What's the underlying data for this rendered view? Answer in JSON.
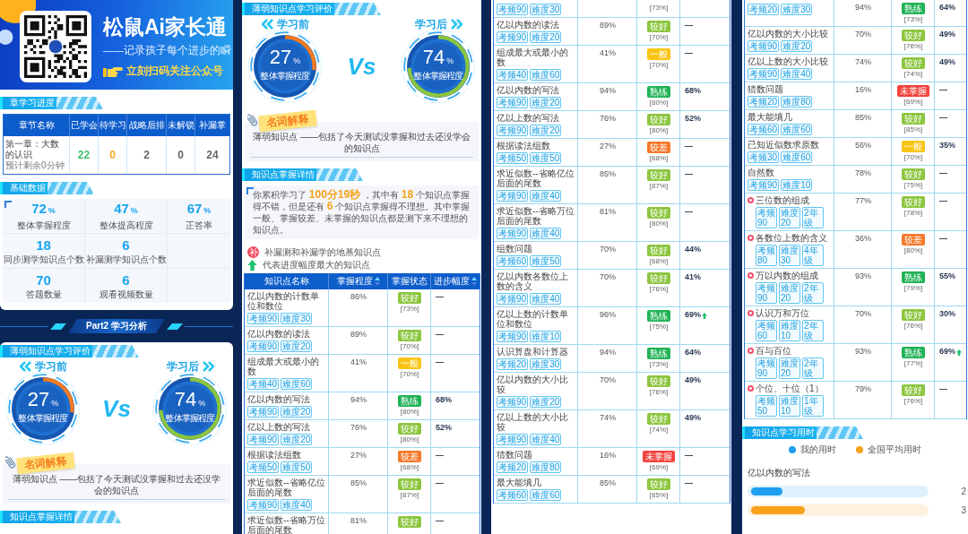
{
  "screens": [
    {
      "blocks": [
        {
          "kind": "card",
          "sections": [
            {
              "kind": "banner",
              "title": "松鼠Ai家长通",
              "subtitle": "——记录孩子每个进步的瞬",
              "cta": "立刻扫码关注公众号"
            },
            {
              "kind": "progress",
              "header": "章学习进度",
              "columns": [
                "章节名称",
                "已学会",
                "待学习",
                "战略后排",
                "未解锁",
                "补漏掌"
              ],
              "rows": [
                {
                  "cells": [
                    {
                      "text": "第一章：大数的认识",
                      "note": "预计剩余0分钟"
                    },
                    {
                      "text": "22",
                      "color": "#3cbf6a"
                    },
                    {
                      "text": "0",
                      "color": "#f5a623"
                    },
                    {
                      "text": "2",
                      "color": "#666666"
                    },
                    {
                      "text": "0",
                      "color": "#666666"
                    },
                    {
                      "text": "24",
                      "color": "#666666"
                    }
                  ]
                }
              ]
            },
            {
              "kind": "stats",
              "header": "基础数据",
              "rows": [
                [
                  {
                    "value": "72",
                    "unit": "%",
                    "label": "整体掌握程度"
                  },
                  {
                    "value": "47",
                    "unit": "%",
                    "label": "整体提高程度"
                  },
                  {
                    "value": "67",
                    "unit": "%",
                    "label": "正答率"
                  }
                ],
                [
                  {
                    "value": "18",
                    "label": "同步测学知识点个数"
                  },
                  {
                    "value": "6",
                    "label": "补漏测学知识点个数"
                  }
                ],
                [
                  {
                    "value": "70",
                    "label": "答题数量"
                  },
                  {
                    "value": "6",
                    "label": "观看视频数量"
                  }
                ]
              ]
            }
          ]
        },
        {
          "kind": "divider",
          "title": "Part2 学习分析"
        },
        {
          "kind": "card",
          "sections": [
            {
              "kind": "evaluation",
              "header": "薄弱知识点学习评价",
              "before": {
                "label": "学习前",
                "value": "27",
                "unit": "%",
                "caption": "整体掌握程度",
                "level": 0.27,
                "color": "#f47b20"
              },
              "versus": "Vs",
              "after": {
                "label": "学习后",
                "value": "74",
                "unit": "%",
                "caption": "整体掌握程度",
                "level": 0.74,
                "color": "#8cc63f"
              }
            },
            {
              "kind": "glossary",
              "tag": "名词解释",
              "text": "薄弱知识点 ——包括了今天测试没掌握和过去还没学会的知识点"
            },
            {
              "kind": "summary",
              "header": "知识点掌握详情"
            }
          ]
        }
      ]
    },
    {
      "blocks": [
        {
          "kind": "card",
          "sections": [
            {
              "kind": "evaluation",
              "header": "薄弱知识点学习评价",
              "before": {
                "label": "学习前",
                "value": "27",
                "unit": "%",
                "caption": "整体掌握程度",
                "level": 0.27,
                "color": "#f47b20"
              },
              "versus": "Vs",
              "after": {
                "label": "学习后",
                "value": "74",
                "unit": "%",
                "caption": "整体掌握程度",
                "level": 0.74,
                "color": "#8cc63f"
              }
            },
            {
              "kind": "glossary",
              "tag": "名词解释",
              "text": "薄弱知识点 ——包括了今天测试没掌握和过去还没学会的知识点"
            },
            {
              "kind": "summary",
              "header": "知识点掌握详情",
              "text": "你累积学习了 **100分19秒** ，其中有 **18** 个知识点掌握得不错，但是还有 **6** 个知识点掌握得不理想。其中掌握一般、掌握较差、未掌握的知识点都是测下来不理想的知识点。"
            },
            {
              "kind": "legend",
              "items": [
                {
                  "kind": "patch",
                  "badge": "补",
                  "text": "补漏测和补漏学的地基知识点"
                },
                {
                  "kind": "top",
                  "text": "代表进度幅度最大的知识点"
                }
              ]
            },
            {
              "kind": "table",
              "columns": [
                {
                  "label": "知识点名称",
                  "sortable": false
                },
                {
                  "label": "掌握程度",
                  "sortable": true
                },
                {
                  "label": "掌握状态",
                  "sortable": false
                },
                {
                  "label": "进步幅度",
                  "sortable": true
                }
              ],
              "rows": [
                {
                  "name": "亿以内数的计数单位和数位",
                  "patch": false,
                  "tags": [
                    "考频90",
                    "难度30"
                  ],
                  "mastery": "86%",
                  "status": "较好",
                  "color": "#8cc63f",
                  "previous": "[73%]",
                  "progress": "—",
                  "top": false
                },
                {
                  "name": "亿以内数的读法",
                  "patch": false,
                  "tags": [
                    "考频90",
                    "难度20"
                  ],
                  "mastery": "89%",
                  "status": "较好",
                  "color": "#8cc63f",
                  "previous": "[70%]",
                  "progress": "—",
                  "top": false
                },
                {
                  "name": "组成最大或最小的数",
                  "patch": false,
                  "tags": [
                    "考频40",
                    "难度60"
                  ],
                  "mastery": "41%",
                  "status": "一般",
                  "color": "#f9c515",
                  "previous": "[70%]",
                  "progress": "—",
                  "top": false
                },
                {
                  "name": "亿以内数的写法",
                  "patch": false,
                  "tags": [
                    "考频90",
                    "难度20"
                  ],
                  "mastery": "94%",
                  "status": "熟练",
                  "color": "#1fb255",
                  "previous": "[80%]",
                  "progress": "68%",
                  "top": false
                },
                {
                  "name": "亿以上数的写法",
                  "patch": false,
                  "tags": [
                    "考频90",
                    "难度20"
                  ],
                  "mastery": "76%",
                  "status": "较好",
                  "color": "#8cc63f",
                  "previous": "[80%]",
                  "progress": "52%",
                  "top": false
                },
                {
                  "name": "根据读法组数",
                  "patch": false,
                  "tags": [
                    "考频50",
                    "难度50"
                  ],
                  "mastery": "27%",
                  "status": "较差",
                  "color": "#f6782a",
                  "previous": "[68%]",
                  "progress": "—",
                  "top": false
                },
                {
                  "name": "求近似数--省略亿位后面的尾数",
                  "patch": false,
                  "tags": [
                    "考频90",
                    "难度40"
                  ],
                  "mastery": "85%",
                  "status": "较好",
                  "color": "#8cc63f",
                  "previous": "[87%]",
                  "progress": "—",
                  "top": false
                },
                {
                  "name": "求近似数--省略万位后面的尾数",
                  "patch": false,
                  "mastery": "81%",
                  "status": "较好",
                  "color": "#8cc63f",
                  "progress": "—",
                  "top": false
                }
              ]
            }
          ]
        }
      ]
    },
    {
      "blocks": [
        {
          "kind": "card",
          "sections": [
            {
              "kind": "table",
              "rows": [
                {
                  "patch": false,
                  "tags": [
                    "考频90",
                    "难度30"
                  ],
                  "previous": "[73%]",
                  "top": false
                },
                {
                  "name": "亿以内数的读法",
                  "patch": false,
                  "tags": [
                    "考频90",
                    "难度20"
                  ],
                  "mastery": "89%",
                  "status": "较好",
                  "color": "#8cc63f",
                  "previous": "[70%]",
                  "progress": "—",
                  "top": false
                },
                {
                  "name": "组成最大或最小的数",
                  "patch": false,
                  "tags": [
                    "考频40",
                    "难度60"
                  ],
                  "mastery": "41%",
                  "status": "一般",
                  "color": "#f9c515",
                  "previous": "[70%]",
                  "progress": "—",
                  "top": false
                },
                {
                  "name": "亿以内数的写法",
                  "patch": false,
                  "tags": [
                    "考频90",
                    "难度20"
                  ],
                  "mastery": "94%",
                  "status": "熟练",
                  "color": "#1fb255",
                  "previous": "[80%]",
                  "progress": "68%",
                  "top": false
                },
                {
                  "name": "亿以上数的写法",
                  "patch": false,
                  "tags": [
                    "考频90",
                    "难度20"
                  ],
                  "mastery": "76%",
                  "status": "较好",
                  "color": "#8cc63f",
                  "previous": "[80%]",
                  "progress": "52%",
                  "top": false
                },
                {
                  "name": "根据读法组数",
                  "patch": false,
                  "tags": [
                    "考频50",
                    "难度50"
                  ],
                  "mastery": "27%",
                  "status": "较差",
                  "color": "#f6782a",
                  "previous": "[68%]",
                  "progress": "—",
                  "top": false
                },
                {
                  "name": "求近似数--省略亿位后面的尾数",
                  "patch": false,
                  "tags": [
                    "考频90",
                    "难度40"
                  ],
                  "mastery": "85%",
                  "status": "较好",
                  "color": "#8cc63f",
                  "previous": "[87%]",
                  "progress": "—",
                  "top": false
                },
                {
                  "name": "求近似数--省略万位后面的尾数",
                  "patch": false,
                  "tags": [
                    "考频90",
                    "难度40"
                  ],
                  "mastery": "81%",
                  "status": "较好",
                  "color": "#8cc63f",
                  "previous": "[80%]",
                  "progress": "—",
                  "top": false
                },
                {
                  "name": "组数问题",
                  "patch": false,
                  "tags": [
                    "考频60",
                    "难度50"
                  ],
                  "mastery": "70%",
                  "status": "较好",
                  "color": "#8cc63f",
                  "previous": "[68%]",
                  "progress": "44%",
                  "top": false
                },
                {
                  "name": "亿以内数各数位上数的含义",
                  "patch": false,
                  "tags": [
                    "考频90",
                    "难度40"
                  ],
                  "mastery": "70%",
                  "status": "较好",
                  "color": "#8cc63f",
                  "previous": "[76%]",
                  "progress": "41%",
                  "top": false
                },
                {
                  "name": "亿以上数的计数单位和数位",
                  "patch": false,
                  "tags": [
                    "考频90",
                    "难度10"
                  ],
                  "mastery": "96%",
                  "status": "熟练",
                  "color": "#1fb255",
                  "previous": "[75%]",
                  "progress": "69%",
                  "top": true
                },
                {
                  "name": "认识算盘和计算器",
                  "patch": false,
                  "tags": [
                    "考频20",
                    "难度30"
                  ],
                  "mastery": "94%",
                  "status": "熟练",
                  "color": "#1fb255",
                  "previous": "[73%]",
                  "progress": "64%",
                  "top": false
                },
                {
                  "name": "亿以内数的大小比较",
                  "patch": false,
                  "tags": [
                    "考频90",
                    "难度20"
                  ],
                  "mastery": "70%",
                  "status": "较好",
                  "color": "#8cc63f",
                  "previous": "[76%]",
                  "progress": "49%",
                  "top": false
                },
                {
                  "name": "亿以上数的大小比较",
                  "patch": false,
                  "tags": [
                    "考频90",
                    "难度40"
                  ],
                  "mastery": "74%",
                  "status": "较好",
                  "color": "#8cc63f",
                  "previous": "[74%]",
                  "progress": "49%",
                  "top": false
                },
                {
                  "name": "猜数问题",
                  "patch": false,
                  "tags": [
                    "考频20",
                    "难度80"
                  ],
                  "mastery": "16%",
                  "status": "未掌握",
                  "color": "#f2433d",
                  "previous": "[69%]",
                  "progress": "—",
                  "top": false
                },
                {
                  "name": "最大能填几",
                  "patch": false,
                  "tags": [
                    "考频60",
                    "难度60"
                  ],
                  "mastery": "85%",
                  "status": "较好",
                  "color": "#8cc63f",
                  "previous": "[85%]",
                  "progress": "—",
                  "top": false
                }
              ]
            }
          ]
        }
      ]
    },
    {
      "blocks": [
        {
          "kind": "card",
          "sections": [
            {
              "kind": "table",
              "rows": [
                {
                  "patch": false,
                  "tags": [
                    "考频20",
                    "难度30"
                  ],
                  "mastery": "94%",
                  "status": "熟练",
                  "color": "#1fb255",
                  "previous": "[73%]",
                  "progress": "64%",
                  "top": false
                },
                {
                  "name": "亿以内数的大小比较",
                  "patch": false,
                  "tags": [
                    "考频90",
                    "难度20"
                  ],
                  "mastery": "70%",
                  "status": "较好",
                  "color": "#8cc63f",
                  "previous": "[76%]",
                  "progress": "49%",
                  "top": false
                },
                {
                  "name": "亿以上数的大小比较",
                  "patch": false,
                  "tags": [
                    "考频90",
                    "难度40"
                  ],
                  "mastery": "74%",
                  "status": "较好",
                  "color": "#8cc63f",
                  "previous": "[74%]",
                  "progress": "49%",
                  "top": false
                },
                {
                  "name": "猜数问题",
                  "patch": false,
                  "tags": [
                    "考频20",
                    "难度80"
                  ],
                  "mastery": "16%",
                  "status": "未掌握",
                  "color": "#f2433d",
                  "previous": "[69%]",
                  "progress": "—",
                  "top": false
                },
                {
                  "name": "最大能填几",
                  "patch": false,
                  "tags": [
                    "考频60",
                    "难度60"
                  ],
                  "mastery": "85%",
                  "status": "较好",
                  "color": "#8cc63f",
                  "previous": "[85%]",
                  "progress": "—",
                  "top": false
                },
                {
                  "name": "已知近似数求原数",
                  "patch": false,
                  "tags": [
                    "考频30",
                    "难度60"
                  ],
                  "mastery": "56%",
                  "status": "一般",
                  "color": "#f9c515",
                  "previous": "[70%]",
                  "progress": "35%",
                  "top": false
                },
                {
                  "name": "自然数",
                  "patch": false,
                  "tags": [
                    "考频90",
                    "难度10"
                  ],
                  "mastery": "78%",
                  "status": "较好",
                  "color": "#8cc63f",
                  "previous": "[75%]",
                  "progress": "—",
                  "top": false
                },
                {
                  "name": "三位数的组成",
                  "patch": true,
                  "tags": [
                    "考频90",
                    "难度20",
                    "2年级"
                  ],
                  "mastery": "77%",
                  "status": "较好",
                  "color": "#8cc63f",
                  "previous": "[78%]",
                  "progress": "—",
                  "top": false
                },
                {
                  "name": "各数位上数的含义",
                  "patch": true,
                  "tags": [
                    "考频80",
                    "难度30",
                    "4年级"
                  ],
                  "mastery": "36%",
                  "status": "较差",
                  "color": "#f6782a",
                  "previous": "[80%]",
                  "progress": "—",
                  "top": false
                },
                {
                  "name": "万以内数的组成",
                  "patch": true,
                  "tags": [
                    "考频90",
                    "难度20",
                    "2年级"
                  ],
                  "mastery": "93%",
                  "status": "熟练",
                  "color": "#1fb255",
                  "previous": "[79%]",
                  "progress": "55%",
                  "top": false
                },
                {
                  "name": "认识万和万位",
                  "patch": true,
                  "tags": [
                    "考频60",
                    "难度10",
                    "2年级"
                  ],
                  "mastery": "70%",
                  "status": "较好",
                  "color": "#8cc63f",
                  "previous": "[76%]",
                  "progress": "30%",
                  "top": false
                },
                {
                  "name": "百与百位",
                  "patch": true,
                  "tags": [
                    "考频90",
                    "难度20",
                    "2年级"
                  ],
                  "mastery": "93%",
                  "status": "熟练",
                  "color": "#1fb255",
                  "previous": "[77%]",
                  "progress": "69%",
                  "top": true
                },
                {
                  "name": "个位、十位（1）",
                  "patch": true,
                  "tags": [
                    "考频50",
                    "难度10",
                    "1年级"
                  ],
                  "mastery": "79%",
                  "status": "较好",
                  "color": "#8cc63f",
                  "previous": "[76%]",
                  "progress": "—",
                  "top": false
                }
              ]
            },
            {
              "kind": "time",
              "header": "知识点学习用时",
              "legend": [
                {
                  "text": "我的用时",
                  "color": "#1e9ff2"
                },
                {
                  "text": "全国平均用时",
                  "color": "#f9a11b"
                }
              ],
              "items": [
                {
                  "name": "亿以内数的写法",
                  "bars": [
                    {
                      "level": 0.18,
                      "value": "2",
                      "color": "#1e9ff2"
                    },
                    {
                      "level": 0.31,
                      "value": "3",
                      "color": "#f9a11b"
                    }
                  ]
                }
              ]
            }
          ]
        }
      ]
    }
  ]
}
